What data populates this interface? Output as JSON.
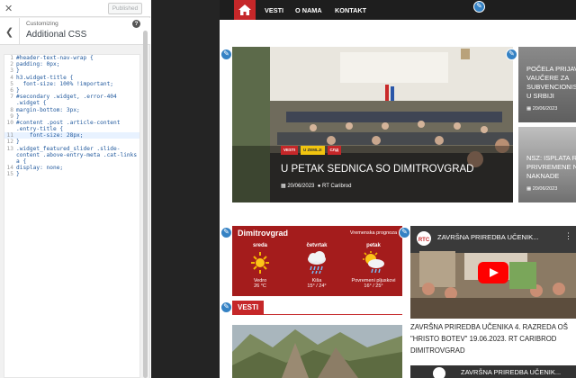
{
  "customizer": {
    "publish_label": "Published",
    "header_sub": "Customizing",
    "header_title": "Additional CSS",
    "code_lines": [
      "#header-text-nav-wrap {",
      "padding: 0px;",
      "}",
      "h3.widget-title {",
      "  font-size: 100% !important;",
      "}",
      "#secondary .widget, .error-404",
      ".widget {",
      "margin-bottom: 3px;",
      "}",
      "#content .post .article-content",
      ".entry-title {",
      "    font-size: 28px;",
      "}",
      ".widget_featured_slider .slide-",
      "content .above-entry-meta .cat-links",
      "a {",
      "display: none;",
      "}"
    ],
    "line_numbers": [
      "1",
      "2",
      "3",
      "4",
      "5",
      "6",
      "7",
      "",
      "8",
      "9",
      "10",
      "",
      "11",
      "12",
      "13",
      "",
      "",
      "14",
      "15"
    ]
  },
  "nav": {
    "items": [
      "VESTI",
      "O NAMA",
      "KONTAKT"
    ]
  },
  "featured": {
    "badges": [
      "VESTI",
      "U ZEMLJI",
      "СЛД"
    ],
    "badge_colors": [
      "#c52729",
      "#f1c40f",
      "#c52729"
    ],
    "title": "U PETAK SEDNICA SO DIMITROVGRAD",
    "date": "20/06/2023",
    "author": "RT Caribrod"
  },
  "side_posts": [
    {
      "title_lines": [
        "POČELA PRIJAV",
        "VAUČERE ZA",
        "SUBVENCIONIS",
        "U SRBIJI"
      ],
      "date": "20/06/2023"
    },
    {
      "title_lines": [
        "NSZ: ISPLATA R",
        "PRIVREMENE N",
        "NAKNADE"
      ],
      "date": "20/06/2023"
    }
  ],
  "weather": {
    "city": "Dimitrovgrad",
    "forecast_label": "Vremenska prognoza",
    "days": [
      {
        "name": "sreda",
        "icon": "sun-icon",
        "desc": "Vedro",
        "temp": "26 °C"
      },
      {
        "name": "četvrtak",
        "icon": "rain-icon",
        "desc": "Kiša",
        "temp": "15° / 24°"
      },
      {
        "name": "petak",
        "icon": "sun-rain-icon",
        "desc": "Povremeni pljuskovi",
        "temp": "16° / 25°"
      }
    ]
  },
  "vesti": {
    "label": "VESTI"
  },
  "video": {
    "title": "ZAVRŠNA PRIREDBA UČENIK...",
    "caption": "ZAVRŠNA PRIREDBA UČENIKA 4. RAZREDA OŠ \"HRISTO BOTEV\" 19.06.2023. RT CARIBROD DIMITROVGRAD",
    "next_title": "ZAVRŠNA PRIREDBA UČENIK..."
  }
}
